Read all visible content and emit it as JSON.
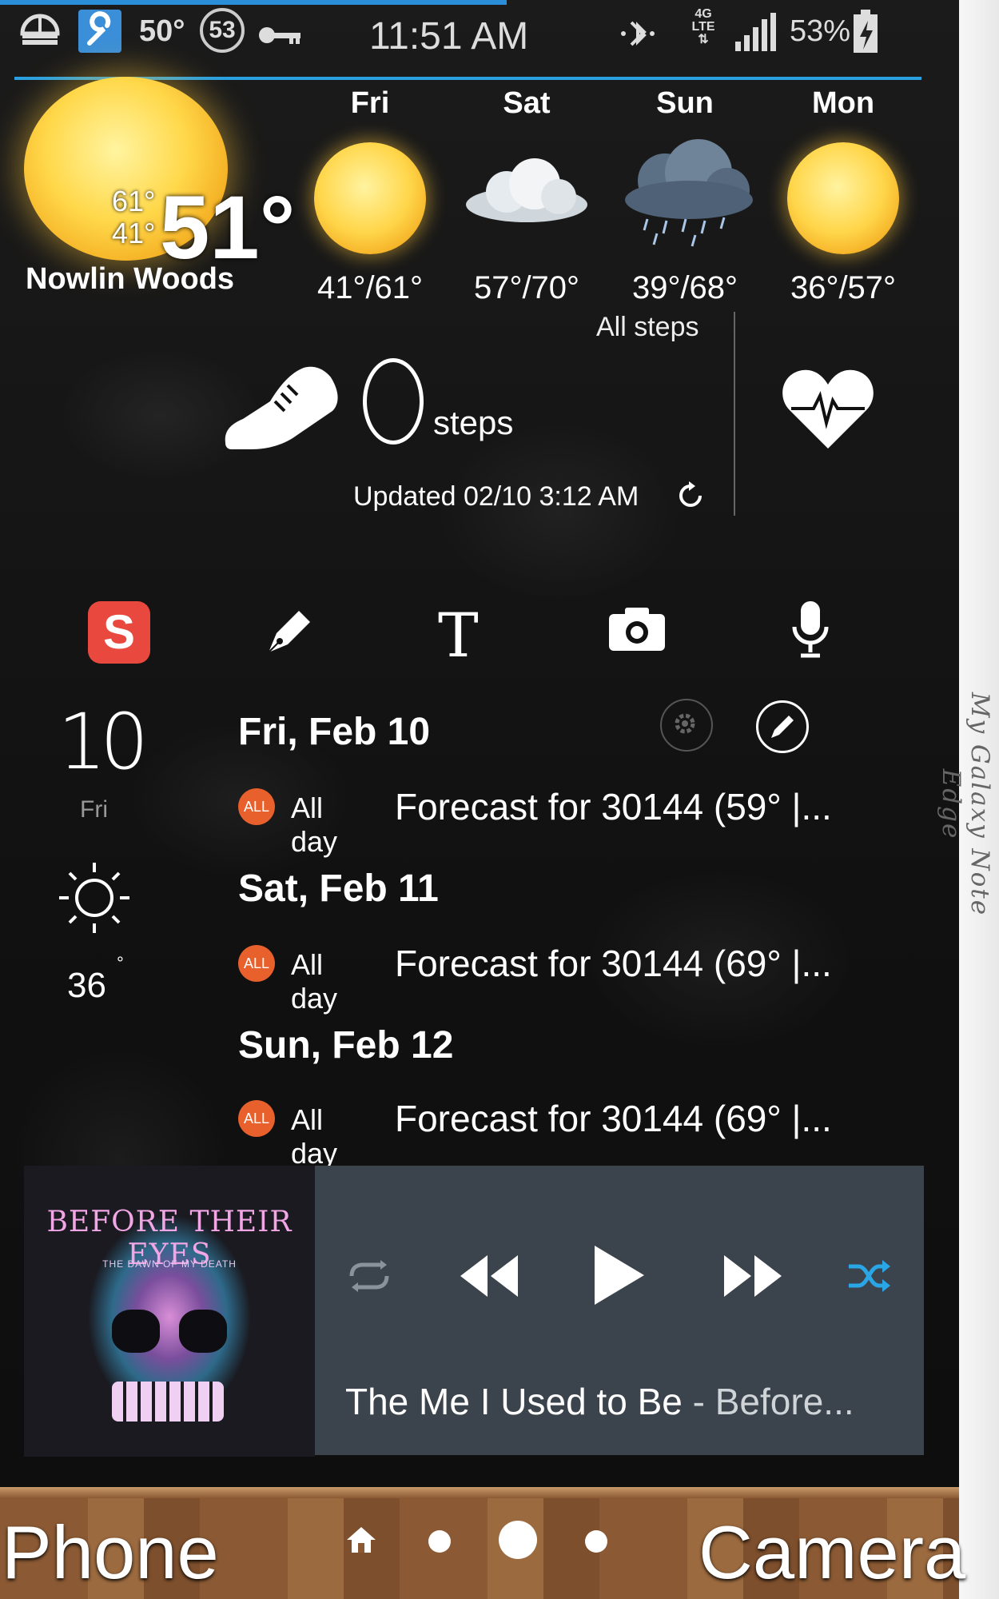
{
  "status_bar": {
    "temperature": "50°",
    "badge_number": "53",
    "time": "11:51 AM",
    "network": "4G LTE",
    "battery": "53%",
    "icons": [
      "storage-icon",
      "wrench-icon",
      "key-icon",
      "bluetooth-icon",
      "signal-icon",
      "battery-charging-icon"
    ],
    "progress_color": "#2a8fd8"
  },
  "weather": {
    "high": "61°",
    "low": "41°",
    "current": "51°",
    "location": "Nowlin Woods",
    "forecast": [
      {
        "day": "Fri",
        "icon": "sun-icon",
        "temps": "41°/61°"
      },
      {
        "day": "Sat",
        "icon": "cloud-icon",
        "temps": "57°/70°"
      },
      {
        "day": "Sun",
        "icon": "rain-cloud-icon",
        "temps": "39°/68°"
      },
      {
        "day": "Mon",
        "icon": "sun-icon",
        "temps": "36°/57°"
      }
    ]
  },
  "steps": {
    "header": "All steps",
    "count": "0",
    "unit": "steps",
    "updated": "Updated 02/10 3:12 AM"
  },
  "quick_actions": [
    "s-note-icon",
    "pen-icon",
    "text-icon",
    "camera-icon",
    "microphone-icon"
  ],
  "calendar": {
    "date_number": "10",
    "day_of_week": "Fri",
    "temperature": "36",
    "events": [
      {
        "heading": "Fri, Feb 10",
        "badge": "ALL",
        "all_day": "All day",
        "text": "Forecast for 30144 (59° |..."
      },
      {
        "heading": "Sat, Feb 11",
        "badge": "ALL",
        "all_day": "All day",
        "text": "Forecast for 30144 (69° |..."
      },
      {
        "heading": "Sun, Feb 12",
        "badge": "ALL",
        "all_day": "All day",
        "text": "Forecast for 30144 (69° |..."
      }
    ]
  },
  "music": {
    "album_text": "BEFORE THEIR EYES",
    "album_subtitle": "THE DAWN OF MY DEATH",
    "track_title": "The Me I Used to Be",
    "artist_suffix": " - Before...",
    "shuffle_color": "#2aa6e6"
  },
  "dock": {
    "left_label": "Phone",
    "right_label": "Camera"
  },
  "edge_panel": {
    "text": "My Galaxy Note Edge"
  }
}
